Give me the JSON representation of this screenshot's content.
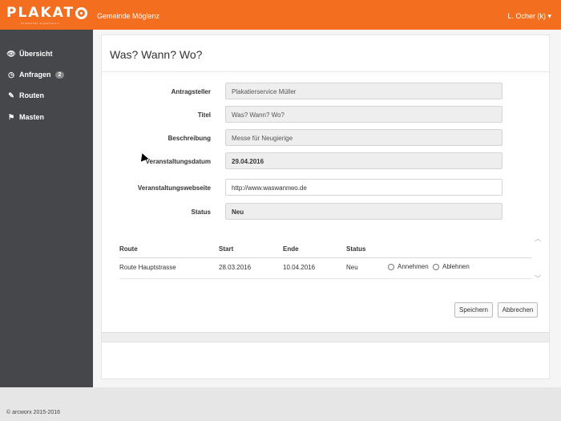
{
  "brand": {
    "logo_text": "PLAKAT",
    "tagline": "kommunal organisiert"
  },
  "header": {
    "municipality": "Gemeinde Möglenz",
    "user": "L. Ocher (k) ▾"
  },
  "sidebar": {
    "items": [
      {
        "label": "Übersicht",
        "icon": "eye-icon"
      },
      {
        "label": "Anfragen",
        "icon": "clock-icon",
        "badge": "2"
      },
      {
        "label": "Routen",
        "icon": "pin-icon"
      },
      {
        "label": "Masten",
        "icon": "flag-icon"
      }
    ]
  },
  "page": {
    "title": "Was? Wann? Wo?"
  },
  "form": {
    "applicant": {
      "label": "Antragsteller",
      "value": "Plakatierservice Müller"
    },
    "title": {
      "label": "Titel",
      "value": "Was? Wann? Wo?"
    },
    "description": {
      "label": "Beschreibung",
      "value": "Messe für Neugierige"
    },
    "event_date": {
      "label": "Veranstaltungsdatum",
      "value": "29.04.2016"
    },
    "event_website": {
      "label": "Veranstaltungswebseite",
      "value": "http://www.waswannwo.de"
    },
    "status": {
      "label": "Status",
      "value": "Neu"
    }
  },
  "routes_table": {
    "headers": {
      "route": "Route",
      "start": "Start",
      "end": "Ende",
      "status": "Status"
    },
    "rows": [
      {
        "route": "Route Hauptstrasse",
        "start": "28.03.2016",
        "end": "10.04.2016",
        "status": "Neu",
        "accept": "Annehmen",
        "reject": "Ablehnen"
      }
    ]
  },
  "actions": {
    "save": "Speichern",
    "cancel": "Abbrechen"
  },
  "footer": {
    "copyright": "© arcworx 2015-2016"
  },
  "colors": {
    "accent": "#f36f1f",
    "sidebar": "#45474b"
  }
}
